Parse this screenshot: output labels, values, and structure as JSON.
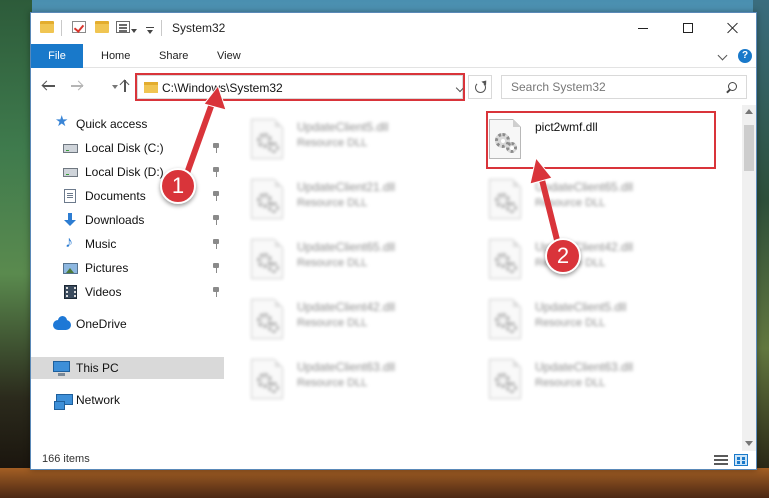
{
  "window": {
    "title": "System32",
    "controls": {
      "minimize": "minimize-icon",
      "maximize": "maximize-icon",
      "close": "close-icon"
    }
  },
  "ribbon": {
    "tabs": [
      {
        "label": "File",
        "active": true
      },
      {
        "label": "Home"
      },
      {
        "label": "Share"
      },
      {
        "label": "View"
      }
    ],
    "help": "?"
  },
  "address": {
    "path": "C:\\Windows\\System32",
    "search_placeholder": "Search System32"
  },
  "navpane": {
    "items": [
      {
        "label": "Quick access",
        "icon": "star-icon"
      },
      {
        "label": "Local Disk (C:)",
        "icon": "drive-icon",
        "pinned": true
      },
      {
        "label": "Local Disk (D:)",
        "icon": "drive-icon",
        "pinned": true
      },
      {
        "label": "Documents",
        "icon": "documents-icon",
        "pinned": true
      },
      {
        "label": "Downloads",
        "icon": "downloads-icon",
        "pinned": true
      },
      {
        "label": "Music",
        "icon": "music-icon",
        "pinned": true
      },
      {
        "label": "Pictures",
        "icon": "pictures-icon",
        "pinned": true
      },
      {
        "label": "Videos",
        "icon": "videos-icon",
        "pinned": true
      },
      {
        "label": "OneDrive",
        "icon": "onedrive-icon"
      },
      {
        "label": "This PC",
        "icon": "this-pc-icon",
        "selected": true
      },
      {
        "label": "Network",
        "icon": "network-icon"
      }
    ]
  },
  "files": [
    {
      "name": "UpdateClient5.dll",
      "type": "Resource DLL"
    },
    {
      "name": "pict2wmf.dll",
      "type": "",
      "highlighted": true
    },
    {
      "name": "UpdateClient21.dll",
      "type": "Resource DLL"
    },
    {
      "name": "UpdateClient65.dll",
      "type": "Resource DLL"
    },
    {
      "name": "UpdateClient65.dll",
      "type": "Resource DLL"
    },
    {
      "name": "UpdateClient42.dll",
      "type": "Resource DLL"
    },
    {
      "name": "UpdateClient42.dll",
      "type": "Resource DLL"
    },
    {
      "name": "UpdateClient5.dll",
      "type": "Resource DLL"
    },
    {
      "name": "UpdateClient63.dll",
      "type": "Resource DLL"
    },
    {
      "name": "UpdateClient63.dll",
      "type": "Resource DLL"
    }
  ],
  "status": {
    "items_count": "166 items"
  },
  "callouts": [
    {
      "number": "1"
    },
    {
      "number": "2"
    }
  ],
  "colors": {
    "accent": "#1979ca",
    "callout": "#d9343a",
    "selected_nav": "#d9d9d9"
  }
}
